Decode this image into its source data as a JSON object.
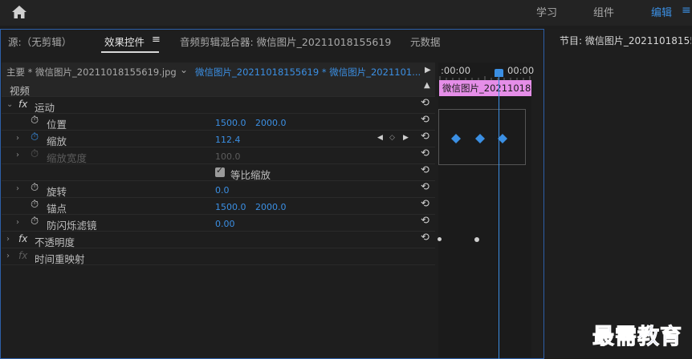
{
  "topbar": {
    "tabs": [
      {
        "label": "学习",
        "active": false
      },
      {
        "label": "组件",
        "active": false
      },
      {
        "label": "编辑",
        "active": true
      }
    ]
  },
  "panel_tabs": {
    "source": "源:（无剪辑）",
    "effects": "效果控件",
    "mixer": "音频剪辑混合器: 微信图片_20211018155619",
    "metadata": "元数据"
  },
  "clip": {
    "master": "主要 * 微信图片_20211018155619.jpg",
    "sequence": "微信图片_20211018155619 * 微信图片_2021101...",
    "timeline_clip": "微信图片_2021101811"
  },
  "timecodes": {
    "start": ":00:00",
    "end": "00:00"
  },
  "section": {
    "video": "视频"
  },
  "properties": {
    "motion": "运动",
    "position": {
      "label": "位置",
      "x": "1500.0",
      "y": "2000.0"
    },
    "scale": {
      "label": "缩放",
      "value": "112.4"
    },
    "scale_width": {
      "label": "缩放宽度",
      "value": "100.0"
    },
    "uniform": {
      "label": "等比缩放",
      "checked": true
    },
    "rotation": {
      "label": "旋转",
      "value": "0.0"
    },
    "anchor": {
      "label": "锚点",
      "x": "1500.0",
      "y": "2000.0"
    },
    "flicker": {
      "label": "防闪烁滤镜",
      "value": "0.00"
    },
    "opacity": "不透明度",
    "time_remap": "时间重映射",
    "fx": "fx"
  },
  "program": {
    "title": "节目: 微信图片_20211018155"
  },
  "watermark": "最需教育",
  "colors": {
    "accent": "#3b8fe3",
    "clip_pink": "#e58ee8",
    "border": "#2d5fa8"
  }
}
